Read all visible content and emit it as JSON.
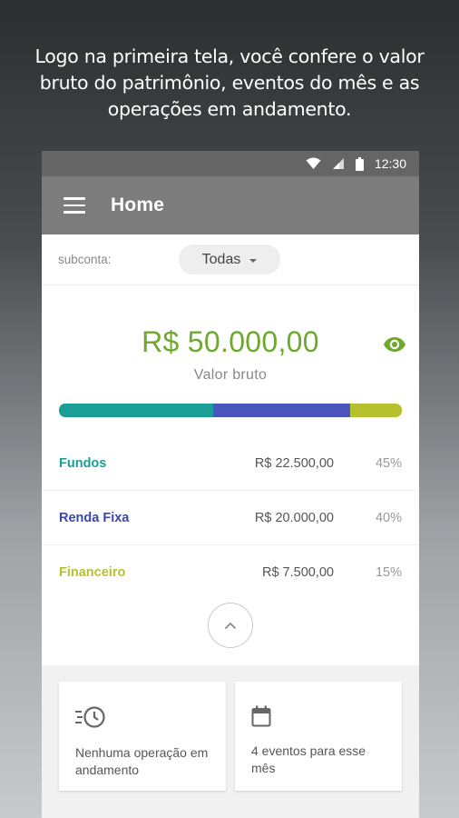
{
  "caption": "Logo na primeira tela, você confere o valor bruto do patrimônio, eventos do mês e as operações em andamento.",
  "status_bar": {
    "time": "12:30"
  },
  "app_bar": {
    "title": "Home"
  },
  "subconta": {
    "label": "subconta:",
    "selected": "Todas"
  },
  "summary": {
    "amount": "R$ 50.000,00",
    "label": "Valor bruto"
  },
  "allocation_bar": [
    {
      "name": "Fundos",
      "fraction": 0.45,
      "color": "#1a9e96"
    },
    {
      "name": "Renda Fixa",
      "fraction": 0.4,
      "color": "#4a56be"
    },
    {
      "name": "Financeiro",
      "fraction": 0.15,
      "color": "#b5c22d"
    }
  ],
  "rows": [
    {
      "name": "Fundos",
      "amount": "R$  22.500,00",
      "pct": "45%",
      "color": "#1a9e96"
    },
    {
      "name": "Renda Fixa",
      "amount": "R$ 20.000,00",
      "pct": "40%",
      "color": "#3a47a8"
    },
    {
      "name": "Financeiro",
      "amount": "R$ 7.500,00",
      "pct": "15%",
      "color": "#b5c22d"
    }
  ],
  "tiles": [
    {
      "icon": "history-clock-icon",
      "text": "Nenhuma operação em andamento"
    },
    {
      "icon": "calendar-icon",
      "text": "4 eventos para esse mês"
    }
  ],
  "colors": {
    "accent_green": "#6ea82d",
    "appbar": "#7c7c7c",
    "statusbar": "#656565"
  }
}
